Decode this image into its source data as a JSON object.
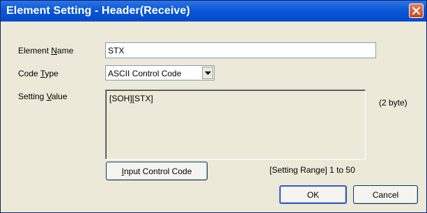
{
  "window": {
    "title": "Element Setting - Header(Receive)"
  },
  "fields": {
    "element_name": {
      "label_pre": "Element ",
      "label_accel": "N",
      "label_post": "ame",
      "value": "STX"
    },
    "code_type": {
      "label_pre": "Code ",
      "label_accel": "T",
      "label_post": "ype",
      "selected": "ASCII Control Code"
    },
    "setting_value": {
      "label_pre": "Setting ",
      "label_accel": "V",
      "label_post": "alue",
      "value": "[SOH][STX]",
      "byte_info": "(2 byte)"
    }
  },
  "buttons": {
    "input_control_code": {
      "accel": "I",
      "rest": "nput Control Code"
    },
    "ok": "OK",
    "cancel": "Cancel"
  },
  "range_text": "[Setting Range] 1 to 50",
  "icons": {
    "close": "close-icon",
    "dropdown": "chevron-down-icon"
  },
  "colors": {
    "titlebar": "#0a58d8",
    "dialog_bg": "#ece9d8",
    "close_button": "#c6441e"
  }
}
